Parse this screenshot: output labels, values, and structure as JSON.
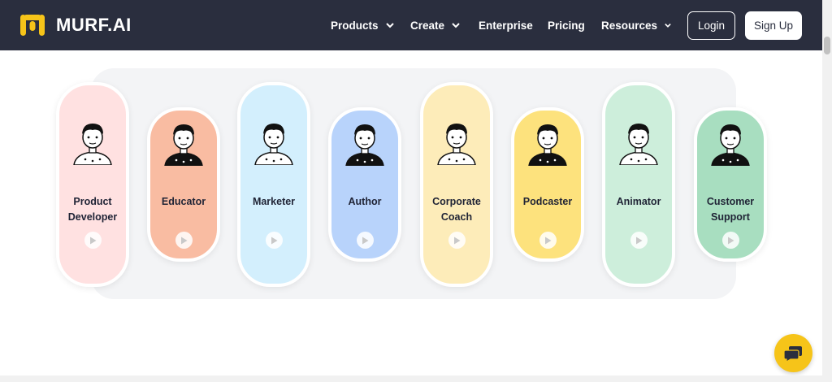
{
  "brand": {
    "name": "MURF.AI",
    "accent": "#f6c419",
    "nav_bg": "#2a2e3e"
  },
  "nav": {
    "items": [
      {
        "label": "Products",
        "has_dropdown": true
      },
      {
        "label": "Create",
        "has_dropdown": true
      },
      {
        "label": "Enterprise",
        "has_dropdown": false
      },
      {
        "label": "Pricing",
        "has_dropdown": false
      },
      {
        "label": "Resources",
        "has_dropdown": true
      }
    ],
    "login_label": "Login",
    "signup_label": "Sign Up"
  },
  "personas": [
    {
      "line1": "Product",
      "line2": "Developer",
      "color": "#ffe1e1",
      "size": "tall"
    },
    {
      "line1": "Educator",
      "line2": "",
      "color": "#f9bca2",
      "size": "short"
    },
    {
      "line1": "Marketer",
      "line2": "",
      "color": "#d3effd",
      "size": "tall"
    },
    {
      "line1": "Author",
      "line2": "",
      "color": "#b8d3fb",
      "size": "short"
    },
    {
      "line1": "Corporate",
      "line2": "Coach",
      "color": "#fdecb9",
      "size": "tall"
    },
    {
      "line1": "Podcaster",
      "line2": "",
      "color": "#fde27d",
      "size": "short"
    },
    {
      "line1": "Animator",
      "line2": "",
      "color": "#cdeedb",
      "size": "tall"
    },
    {
      "line1": "Customer",
      "line2": "Support",
      "color": "#a8dec0",
      "size": "short"
    }
  ],
  "icons": {
    "play": "play-icon",
    "chat": "chat-icon",
    "chevron": "chevron-down-icon"
  }
}
